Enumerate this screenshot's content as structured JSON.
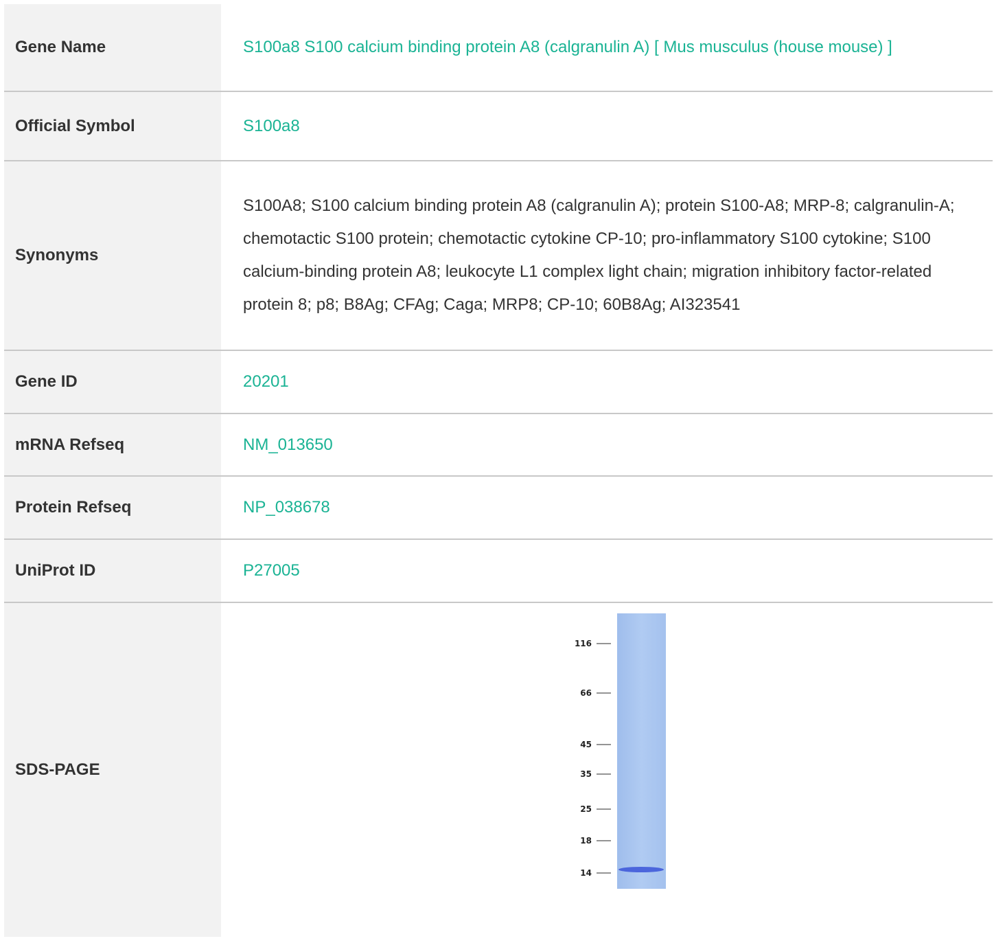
{
  "rows": {
    "gene_name": {
      "label": "Gene Name",
      "value": "S100a8 S100 calcium binding protein A8 (calgranulin A) [ Mus musculus (house mouse) ]"
    },
    "official_symbol": {
      "label": "Official Symbol",
      "value": "S100a8"
    },
    "synonyms": {
      "label": "Synonyms",
      "value": "S100A8; S100 calcium binding protein A8 (calgranulin A); protein S100-A8; MRP-8; calgranulin-A; chemotactic S100 protein; chemotactic cytokine CP-10; pro-inflammatory S100 cytokine; S100 calcium-binding protein A8; leukocyte L1 complex light chain; migration inhibitory factor-related protein 8; p8; B8Ag; CFAg; Caga; MRP8; CP-10; 60B8Ag; AI323541"
    },
    "gene_id": {
      "label": "Gene ID",
      "value": "20201"
    },
    "mrna_refseq": {
      "label": "mRNA Refseq",
      "value": "NM_013650"
    },
    "protein_refseq": {
      "label": "Protein Refseq",
      "value": "NP_038678"
    },
    "uniprot_id": {
      "label": "UniProt ID",
      "value": "P27005"
    },
    "sds_page": {
      "label": "SDS-PAGE",
      "gel": {
        "markers_kda": [
          "116",
          "66",
          "45",
          "35",
          "25",
          "18",
          "14"
        ],
        "band_kda": 14
      }
    }
  },
  "colors": {
    "link": "#1ab394",
    "label_bg": "#f2f2f2",
    "divider": "#c8c8c8",
    "gel_lane": "#a9c6f0",
    "gel_band": "#3b55d8"
  }
}
